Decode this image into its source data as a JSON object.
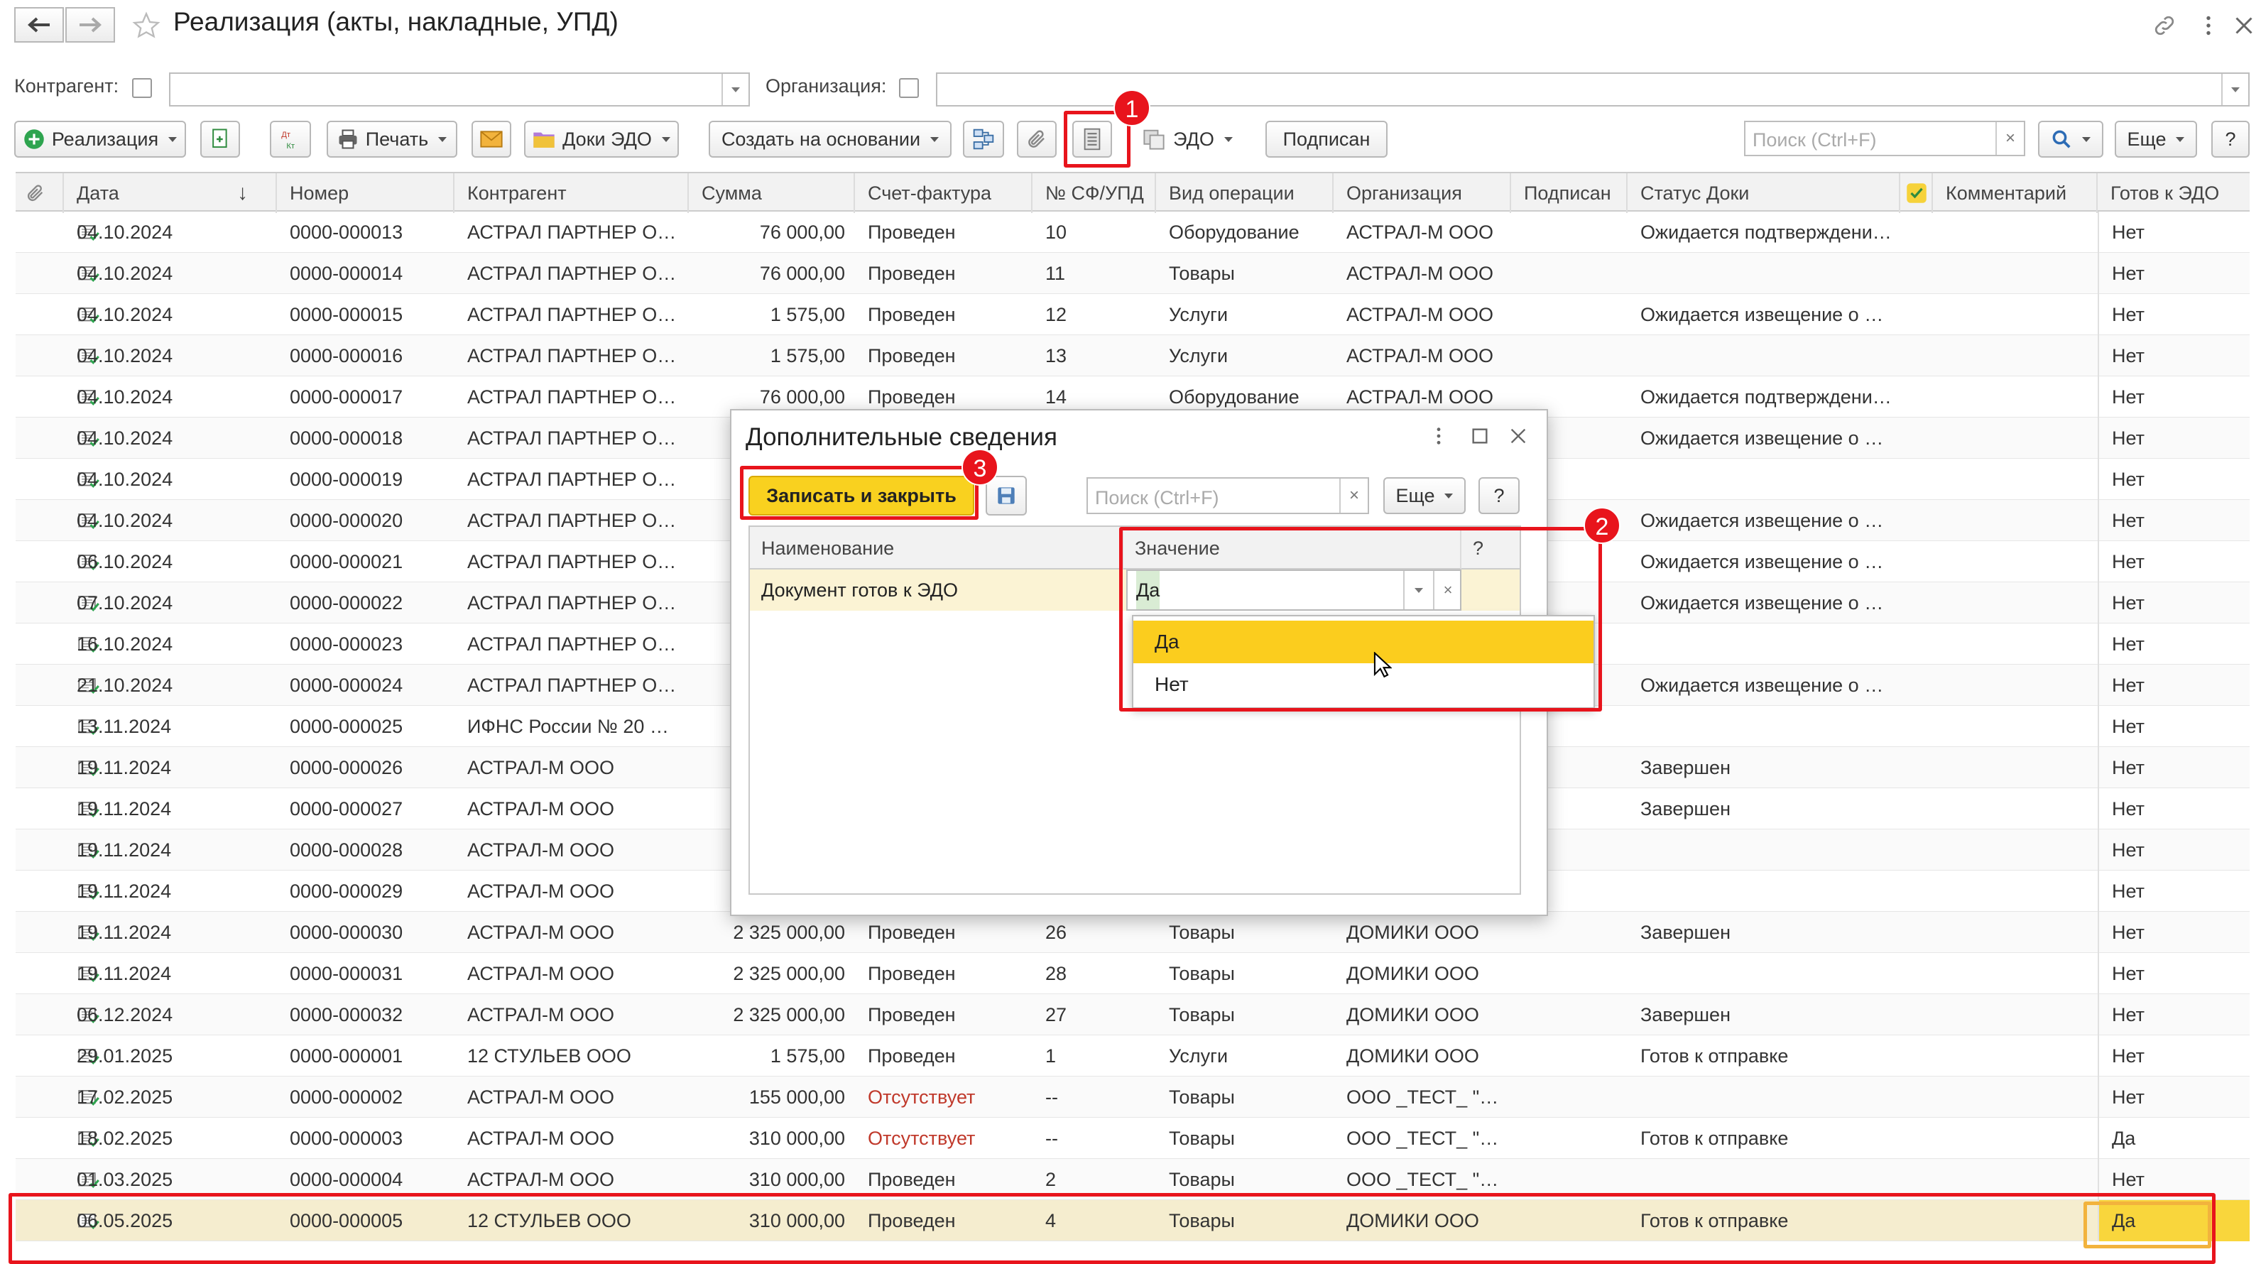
{
  "window": {
    "title": "Реализация (акты, накладные, УПД)"
  },
  "filters": {
    "counterparty_label": "Контрагент:",
    "organization_label": "Организация:"
  },
  "toolbar": {
    "realization": "Реализация",
    "print": "Печать",
    "edo_docs": "Доки ЭДО",
    "create_based": "Создать на основании",
    "edo": "ЭДО",
    "signed": "Подписан",
    "search_placeholder": "Поиск (Ctrl+F)",
    "more": "Еще",
    "help": "?"
  },
  "columns": [
    "Дата",
    "Номер",
    "Контрагент",
    "Сумма",
    "Счет-фактура",
    "№ СФ/УПД",
    "Вид операции",
    "Организация",
    "Подписан",
    "Статус Доки",
    "Комментарий",
    "Готов к ЭДО"
  ],
  "rows": [
    {
      "date": "04.10.2024",
      "num": "0000-000013",
      "cp": "АСТРАЛ ПАРТНЕР О…",
      "sum": "76 000,00",
      "inv": "Проведен",
      "sf": "10",
      "op": "Оборудование",
      "org": "АСТРАЛ-М ООО",
      "status": "Ожидается подтверждени…",
      "ready": "Нет"
    },
    {
      "date": "04.10.2024",
      "num": "0000-000014",
      "cp": "АСТРАЛ ПАРТНЕР О…",
      "sum": "76 000,00",
      "inv": "Проведен",
      "sf": "11",
      "op": "Товары",
      "org": "АСТРАЛ-М ООО",
      "status": "",
      "ready": "Нет"
    },
    {
      "date": "04.10.2024",
      "num": "0000-000015",
      "cp": "АСТРАЛ ПАРТНЕР О…",
      "sum": "1 575,00",
      "inv": "Проведен",
      "sf": "12",
      "op": "Услуги",
      "org": "АСТРАЛ-М ООО",
      "status": "Ожидается извещение о …",
      "ready": "Нет"
    },
    {
      "date": "04.10.2024",
      "num": "0000-000016",
      "cp": "АСТРАЛ ПАРТНЕР О…",
      "sum": "1 575,00",
      "inv": "Проведен",
      "sf": "13",
      "op": "Услуги",
      "org": "АСТРАЛ-М ООО",
      "status": "",
      "ready": "Нет"
    },
    {
      "date": "04.10.2024",
      "num": "0000-000017",
      "cp": "АСТРАЛ ПАРТНЕР О…",
      "sum": "76 000,00",
      "inv": "Проведен",
      "sf": "14",
      "op": "Оборудование",
      "org": "АСТРАЛ-М ООО",
      "status": "Ожидается подтверждени…",
      "ready": "Нет"
    },
    {
      "date": "04.10.2024",
      "num": "0000-000018",
      "cp": "АСТРАЛ ПАРТНЕР О…",
      "sum": "",
      "inv": "",
      "sf": "",
      "op": "",
      "org": "",
      "status": "Ожидается извещение о …",
      "ready": "Нет"
    },
    {
      "date": "04.10.2024",
      "num": "0000-000019",
      "cp": "АСТРАЛ ПАРТНЕР О…",
      "sum": "",
      "inv": "",
      "sf": "",
      "op": "",
      "org": "",
      "status": "",
      "ready": "Нет"
    },
    {
      "date": "04.10.2024",
      "num": "0000-000020",
      "cp": "АСТРАЛ ПАРТНЕР О…",
      "sum": "",
      "inv": "",
      "sf": "",
      "op": "",
      "org": "",
      "status": "Ожидается извещение о …",
      "ready": "Нет"
    },
    {
      "date": "06.10.2024",
      "num": "0000-000021",
      "cp": "АСТРАЛ ПАРТНЕР О…",
      "sum": "",
      "inv": "",
      "sf": "",
      "op": "",
      "org": "",
      "status": "Ожидается извещение о …",
      "ready": "Нет"
    },
    {
      "date": "07.10.2024",
      "num": "0000-000022",
      "cp": "АСТРАЛ ПАРТНЕР О…",
      "sum": "",
      "inv": "",
      "sf": "",
      "op": "",
      "org": "",
      "status": "Ожидается извещение о …",
      "ready": "Нет"
    },
    {
      "date": "16.10.2024",
      "num": "0000-000023",
      "cp": "АСТРАЛ ПАРТНЕР О…",
      "sum": "",
      "inv": "",
      "sf": "",
      "op": "",
      "org": "",
      "status": "",
      "ready": "Нет"
    },
    {
      "date": "21.10.2024",
      "num": "0000-000024",
      "cp": "АСТРАЛ ПАРТНЕР О…",
      "sum": "",
      "inv": "",
      "sf": "",
      "op": "",
      "org": "",
      "status": "Ожидается извещение о …",
      "ready": "Нет"
    },
    {
      "date": "13.11.2024",
      "num": "0000-000025",
      "cp": "ИФНС России № 20 …",
      "sum": "",
      "inv": "",
      "sf": "",
      "op": "",
      "org": "",
      "status": "",
      "ready": "Нет"
    },
    {
      "date": "19.11.2024",
      "num": "0000-000026",
      "cp": "АСТРАЛ-М ООО",
      "sum": "2",
      "inv": "",
      "sf": "",
      "op": "",
      "org": "",
      "status": "Завершен",
      "ready": "Нет"
    },
    {
      "date": "19.11.2024",
      "num": "0000-000027",
      "cp": "АСТРАЛ-М ООО",
      "sum": "",
      "inv": "",
      "sf": "",
      "op": "",
      "org": "",
      "status": "Завершен",
      "ready": "Нет"
    },
    {
      "date": "19.11.2024",
      "num": "0000-000028",
      "cp": "АСТРАЛ-М ООО",
      "sum": "2",
      "inv": "",
      "sf": "",
      "op": "",
      "org": "",
      "status": "",
      "ready": "Нет"
    },
    {
      "date": "19.11.2024",
      "num": "0000-000029",
      "cp": "АСТРАЛ-М ООО",
      "sum": "2",
      "inv": "",
      "sf": "",
      "op": "",
      "org": "",
      "status": "",
      "ready": "Нет"
    },
    {
      "date": "19.11.2024",
      "num": "0000-000030",
      "cp": "АСТРАЛ-М ООО",
      "sum": "2 325 000,00",
      "inv": "Проведен",
      "sf": "26",
      "op": "Товары",
      "org": "ДОМИКИ ООО",
      "status": "Завершен",
      "ready": "Нет"
    },
    {
      "date": "19.11.2024",
      "num": "0000-000031",
      "cp": "АСТРАЛ-М ООО",
      "sum": "2 325 000,00",
      "inv": "Проведен",
      "sf": "28",
      "op": "Товары",
      "org": "ДОМИКИ ООО",
      "status": "",
      "ready": "Нет"
    },
    {
      "date": "06.12.2024",
      "num": "0000-000032",
      "cp": "АСТРАЛ-М ООО",
      "sum": "2 325 000,00",
      "inv": "Проведен",
      "sf": "27",
      "op": "Товары",
      "org": "ДОМИКИ ООО",
      "status": "Завершен",
      "ready": "Нет"
    },
    {
      "date": "29.01.2025",
      "num": "0000-000001",
      "cp": "12 СТУЛЬЕВ ООО",
      "sum": "1 575,00",
      "inv": "Проведен",
      "sf": "1",
      "op": "Услуги",
      "org": "ДОМИКИ ООО",
      "status": "Готов к отправке",
      "ready": "Нет"
    },
    {
      "date": "17.02.2025",
      "num": "0000-000002",
      "cp": "АСТРАЛ-М ООО",
      "sum": "155 000,00",
      "inv": "Отсутствует",
      "sf": "--",
      "op": "Товары",
      "org": "ООО _ТЕСТ_ \"…",
      "status": "",
      "ready": "Нет"
    },
    {
      "date": "18.02.2025",
      "num": "0000-000003",
      "cp": "АСТРАЛ-М ООО",
      "sum": "310 000,00",
      "inv": "Отсутствует",
      "sf": "--",
      "op": "Товары",
      "org": "ООО _ТЕСТ_ \"…",
      "status": "Готов к отправке",
      "ready": "Да"
    },
    {
      "date": "01.03.2025",
      "num": "0000-000004",
      "cp": "АСТРАЛ-М ООО",
      "sum": "310 000,00",
      "inv": "Проведен",
      "sf": "2",
      "op": "Товары",
      "org": "ООО _ТЕСТ_ \"…",
      "status": "",
      "ready": "Нет"
    },
    {
      "date": "06.05.2025",
      "num": "0000-000005",
      "cp": "12 СТУЛЬЕВ ООО",
      "sum": "310 000,00",
      "inv": "Проведен",
      "sf": "4",
      "op": "Товары",
      "org": "ДОМИКИ ООО",
      "status": "Готов к отправке",
      "ready": "Да"
    }
  ],
  "modal": {
    "title": "Дополнительные сведения",
    "save_close": "Записать и закрыть",
    "search_placeholder": "Поиск (Ctrl+F)",
    "more": "Еще",
    "help": "?",
    "col_name": "Наименование",
    "col_value": "Значение",
    "col_q": "?",
    "row_name": "Документ готов к ЭДО",
    "row_value": "Да",
    "options": [
      "Да",
      "Нет"
    ]
  },
  "badges": [
    "1",
    "2",
    "3"
  ],
  "colors": {
    "accent_yellow": "#f9d11f",
    "annotation_red": "#e8141c",
    "selected_row": "#f5edcf",
    "dropdown_highlight": "#fbcd1e"
  }
}
